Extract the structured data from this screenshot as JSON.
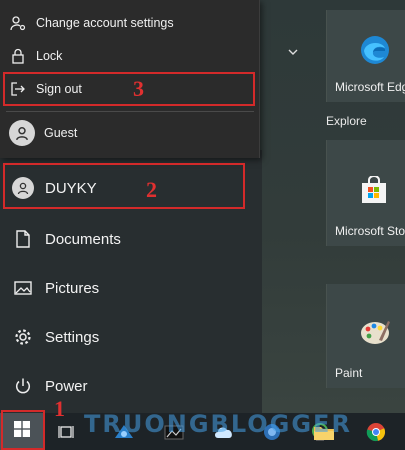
{
  "account_menu": {
    "change_settings": "Change account settings",
    "lock": "Lock",
    "sign_out": "Sign out",
    "guest": "Guest"
  },
  "rail": {
    "user": "DUYKY",
    "documents": "Documents",
    "pictures": "Pictures",
    "settings": "Settings",
    "power": "Power"
  },
  "tiles": {
    "edge": "Microsoft Edge",
    "group_explore": "Explore",
    "store": "Microsoft Store",
    "paint": "Paint"
  },
  "annotations": {
    "step1": "1",
    "step2": "2",
    "step3": "3"
  },
  "watermark": "TRUONGBLOGGER",
  "icons": {
    "change_settings": "person-gear-icon",
    "lock": "lock-icon",
    "sign_out": "sign-out-icon",
    "guest": "user-avatar-icon",
    "user": "user-avatar-icon",
    "documents": "document-icon",
    "pictures": "picture-icon",
    "settings": "gear-icon",
    "power": "power-icon",
    "start": "windows-logo-icon",
    "task_view": "task-view-icon"
  },
  "colors": {
    "annotation_red": "#d32a2a",
    "flyout_bg": "#2b2b2b",
    "taskbar_bg": "#1d2327"
  }
}
